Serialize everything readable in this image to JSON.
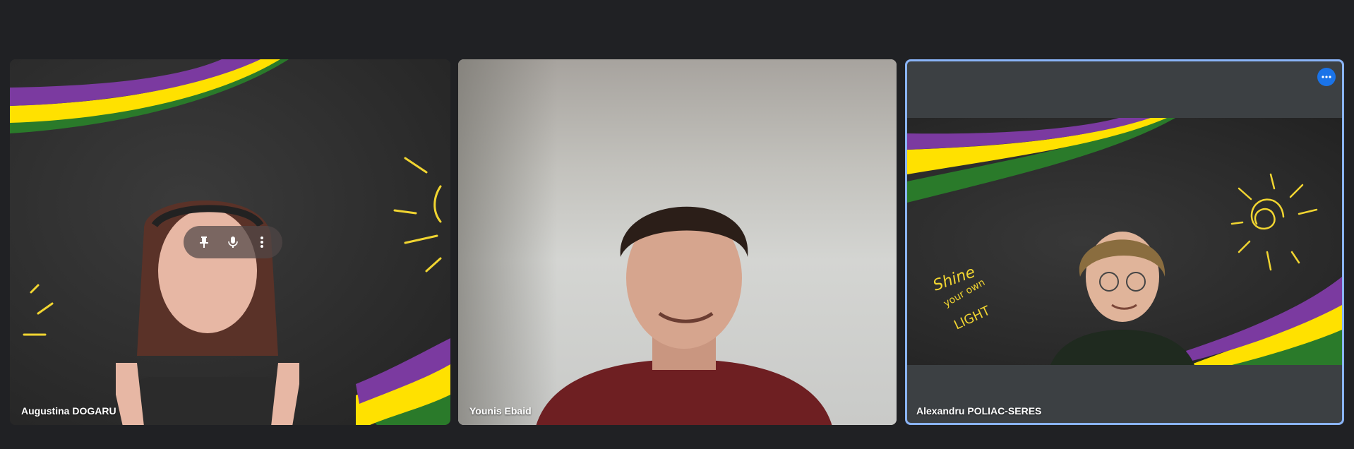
{
  "participants": [
    {
      "name": "Augustina DOGARU"
    },
    {
      "name": "Younis Ebaid"
    },
    {
      "name": "Alexandru POLIAC-SERES"
    }
  ],
  "tile_controls": {
    "pin_icon": "pin-icon",
    "mic_icon": "microphone-icon",
    "more_icon": "more-vertical-icon"
  },
  "active_tile": {
    "more_icon": "more-horizontal-icon",
    "accent_color": "#8ab4f8",
    "button_color": "#1a73e8"
  },
  "background_text": {
    "shine": "Shine",
    "your_own": "your own",
    "light": "LIGHT"
  },
  "colors": {
    "page_bg": "#202124",
    "stripe_purple": "#7b3aa0",
    "stripe_yellow": "#ffe100",
    "stripe_green": "#2a7a2a",
    "chalk_yellow": "#f1d531"
  }
}
